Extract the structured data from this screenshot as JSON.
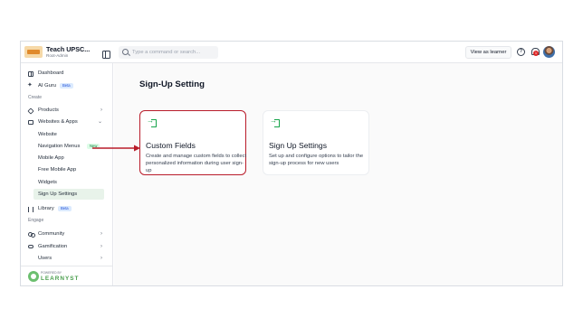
{
  "header": {
    "app_name": "Teach UPSC...",
    "role": "Root-Admin",
    "search_placeholder": "Type a command or search...",
    "view_as_learner": "View as learner",
    "notification_count": "1",
    "help_glyph": "?"
  },
  "sidebar": {
    "items": [
      {
        "label": "Dashboard",
        "icon": "dashboard-icon"
      },
      {
        "label": "AI Guru",
        "icon": "sparkle-icon",
        "badge": "Beta"
      }
    ],
    "section_create": "Create",
    "create_items": [
      {
        "label": "Products",
        "icon": "box-icon",
        "chevron": "›"
      },
      {
        "label": "Websites & Apps",
        "icon": "monitor-icon",
        "chevron": "⌄"
      }
    ],
    "sub_items": [
      {
        "label": "Website"
      },
      {
        "label": "Navigation Menus",
        "badge": "New"
      },
      {
        "label": "Mobile App"
      },
      {
        "label": "Free Mobile App"
      },
      {
        "label": "Widgets"
      },
      {
        "label": "Sign Up Settings",
        "active": true
      }
    ],
    "library": {
      "label": "Library",
      "badge": "Beta",
      "icon": "library-icon"
    },
    "section_engage": "Engage",
    "engage_items": [
      {
        "label": "Community",
        "icon": "people-icon",
        "chevron": "›"
      },
      {
        "label": "Gamification",
        "icon": "gamepad-icon",
        "chevron": "›"
      },
      {
        "label": "Users",
        "chevron": "›"
      }
    ],
    "footer": {
      "powered_by": "POWERED BY",
      "brand": "LEARNYST"
    }
  },
  "main": {
    "title": "Sign-Up Setting",
    "cards": [
      {
        "title": "Custom Fields",
        "description": "Create and manage custom fields to collect personalized information during user sign-up",
        "icon": "login-icon",
        "highlighted": true
      },
      {
        "title": "Sign Up Settings",
        "description": "Set up and configure options to tailor the sign-up process for new users",
        "icon": "login-icon",
        "highlighted": false
      }
    ]
  },
  "colors": {
    "accent_green": "#16a34a",
    "highlight_red": "#b91c2a",
    "active_bg": "#e8f3ea"
  }
}
